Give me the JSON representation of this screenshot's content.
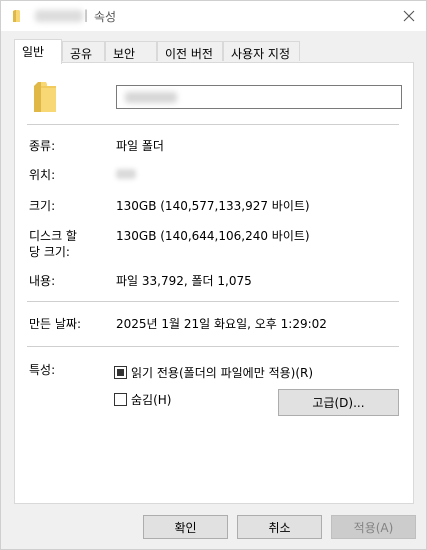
{
  "title": {
    "separator": "|",
    "suffix": "속성"
  },
  "tabs": [
    {
      "label": "일반",
      "active": true
    },
    {
      "label": "공유",
      "active": false
    },
    {
      "label": "보안",
      "active": false
    },
    {
      "label": "이전 버전",
      "active": false
    },
    {
      "label": "사용자 지정",
      "active": false
    }
  ],
  "properties": {
    "type_label": "종류:",
    "type_value": "파일 폴더",
    "location_label": "위치:",
    "size_label": "크기:",
    "size_value": "130GB (140,577,133,927 바이트)",
    "disk_label_line1": "디스크 할",
    "disk_label_line2": "당 크기:",
    "disk_value": "130GB (140,644,106,240 바이트)",
    "contains_label": "내용:",
    "contains_value": "파일 33,792, 폴더 1,075",
    "created_label": "만든 날짜:",
    "created_value": "2025년 1월 21일 화요일, 오후 1:29:02",
    "attributes_label": "특성:",
    "readonly_label": "읽기 전용(폴더의 파일에만 적용)(R)",
    "readonly_state": "indeterminate",
    "hidden_label": "숨김(H)",
    "hidden_state": "unchecked",
    "advanced_label": "고급(D)..."
  },
  "footer": {
    "ok_label": "확인",
    "cancel_label": "취소",
    "apply_label": "적용(A)"
  },
  "icons": {
    "folder": "folder-icon",
    "close": "close-icon"
  },
  "colors": {
    "folder_yellow": "#f8d775",
    "folder_shade": "#e0b848"
  }
}
